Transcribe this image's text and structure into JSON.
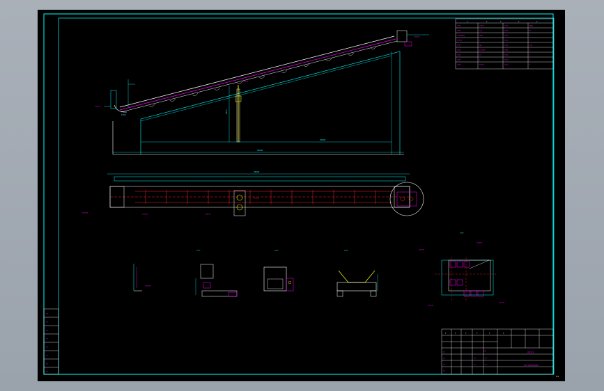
{
  "colors": {
    "background": "#000000",
    "frame": "#00ffff",
    "outline": "#ffffff",
    "dimension": "#00ffff",
    "annotation": "#ff00ff",
    "centerline": "#ff2020",
    "highlight": "#ffff00",
    "accent": "#00ff00"
  },
  "labels": {
    "main_callout": "??????",
    "section_tag": "A-A",
    "detail_title": "????",
    "view_b": "????",
    "view_c": "????",
    "view_d": "????",
    "sheet_number": "1/1",
    "drawing_name": "??????",
    "drawing_code": "DTII 500X20000",
    "company": "??",
    "dim_total": "26000",
    "dim_span": "20000",
    "dim_height": "6500",
    "dim_short": "1200",
    "dim_mid": "8000"
  },
  "tech_table": {
    "rows": [
      [
        "?",
        "?",
        "?",
        "?",
        "?"
      ],
      [
        "????",
        "?????",
        "????",
        "800"
      ],
      [
        "????",
        "2.0",
        "????",
        "8"
      ],
      [
        "????(t/h)",
        "200",
        "????",
        "?"
      ],
      [
        "?????",
        "?",
        "????",
        "?"
      ],
      [
        "????",
        "50",
        "????",
        "7.5"
      ],
      [
        "????",
        "??????",
        "????",
        "?"
      ],
      [
        "????",
        "??",
        "????",
        "?"
      ],
      [
        "????",
        "?",
        "????",
        "?"
      ],
      [
        "????",
        "?????",
        "????",
        "?"
      ]
    ]
  },
  "left_block": {
    "rows": [
      "??",
      "??",
      "??",
      "??",
      "??",
      "??",
      "??",
      "??"
    ]
  },
  "title_block": {
    "head": [
      "?",
      "?",
      "?",
      "?",
      "?",
      "?"
    ],
    "cells": [
      "??",
      "??",
      "??",
      "??",
      "??",
      "??",
      "??",
      "??"
    ]
  }
}
